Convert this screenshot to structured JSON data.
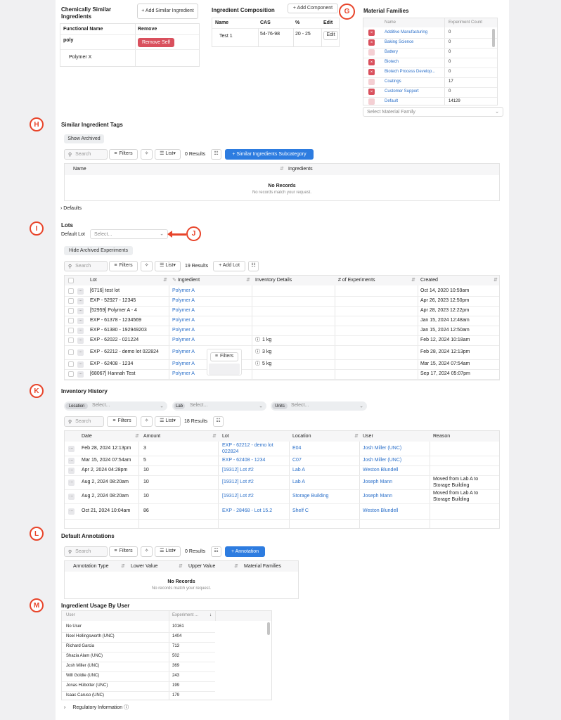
{
  "markers": {
    "g": "G",
    "h": "H",
    "i": "I",
    "j": "J",
    "k": "K",
    "l": "L",
    "m": "M"
  },
  "chem": {
    "title": "Chemically Similar Ingredients",
    "add_label": "+ Add Similar Ingredient",
    "col_name": "Functional Name",
    "col_remove": "Remove",
    "row1_name": "poly",
    "remove_label": "Remove Self",
    "row2_name": "Polymer X"
  },
  "comp": {
    "title": "Ingredient Composition",
    "add_label": "+ Add Component",
    "cols": {
      "name": "Name",
      "cas": "CAS",
      "pct": "%",
      "edit": "Edit"
    },
    "row": {
      "name": "Test 1",
      "cas": "54-76-98",
      "pct": "20 - 25",
      "edit": "Edit"
    }
  },
  "families": {
    "title": "Material Families",
    "col_name": "Name",
    "col_count": "Experiment Count",
    "rows": [
      {
        "name": "Additive Manufacturing",
        "count": "0",
        "on": true
      },
      {
        "name": "Baking Science",
        "count": "0",
        "on": true
      },
      {
        "name": "Battery",
        "count": "0",
        "on": false
      },
      {
        "name": "Biotech",
        "count": "0",
        "on": true
      },
      {
        "name": "Biotech Process Develop...",
        "count": "0",
        "on": true
      },
      {
        "name": "Coatings",
        "count": "17",
        "on": false
      },
      {
        "name": "Customer Support",
        "count": "0",
        "on": true
      },
      {
        "name": "Default",
        "count": "14129",
        "on": false
      }
    ],
    "select_placeholder": "Select Material Family"
  },
  "tags": {
    "title": "Similar Ingredient Tags",
    "show_archived": "Show Archived",
    "search": "Search",
    "filters": "Filters",
    "list": "List",
    "results": "0 Results",
    "primary": "+ Similar Ingredients Subcategory",
    "col_name": "Name",
    "col_ingredients": "Ingredients",
    "empty_title": "No Records",
    "empty_sub": "No records match your request."
  },
  "defaults_label": "Defaults",
  "lots": {
    "title": "Lots",
    "default_lot": "Default Lot",
    "select_placeholder": "Select...",
    "hide_archived": "Hide Archived Experiments",
    "search": "Search",
    "filters": "Filters",
    "list": "List",
    "results": "19 Results",
    "add": "+ Add Lot",
    "cols": {
      "lot": "Lot",
      "ingredient": "Ingredient",
      "inventory": "Inventory Details",
      "experiments": "# of Experiments",
      "created": "Created"
    },
    "rows": [
      {
        "lot": "[6716] test lot",
        "ingredient": "Polymer A",
        "inv": "",
        "created": "Oct 14, 2020 10:59am"
      },
      {
        "lot": "EXP - 52927 - 12345",
        "ingredient": "Polymer A",
        "inv": "",
        "created": "Apr 26, 2023 12:50pm"
      },
      {
        "lot": "[52959] Polymer A - 4",
        "ingredient": "Polymer A",
        "inv": "",
        "created": "Apr 28, 2023 12:22pm"
      },
      {
        "lot": "EXP - 61378 - 1234569",
        "ingredient": "Polymer A",
        "inv": "",
        "created": "Jan 15, 2024 12:48am"
      },
      {
        "lot": "EXP - 61380 - 192949203",
        "ingredient": "Polymer A",
        "inv": "",
        "created": "Jan 15, 2024 12:50am"
      },
      {
        "lot": "EXP - 62022 - 021224",
        "ingredient": "Polymer A",
        "inv": "1 kg",
        "created": "Feb 12, 2024 10:18am"
      },
      {
        "lot": "EXP - 62212 - demo lot 022824",
        "ingredient": "Polymer A",
        "inv": "3 kg",
        "created": "Feb 28, 2024 12:13pm"
      },
      {
        "lot": "EXP - 62408 - 1234",
        "ingredient": "Polymer A",
        "inv": "5 kg",
        "created": "Mar 15, 2024 07:54am"
      },
      {
        "lot": "[68067] Hannah Test",
        "ingredient": "Polymer A",
        "inv": "",
        "created": "Sep 17, 2024 05:07pm"
      }
    ],
    "popup_filters": "Filters"
  },
  "inv": {
    "title": "Inventory History",
    "location": "Location",
    "lab": "Lab",
    "units": "Units",
    "select": "Select...",
    "search": "Search",
    "filters": "Filters",
    "list": "List",
    "results": "18 Results",
    "cols": {
      "date": "Date",
      "amount": "Amount",
      "lot": "Lot",
      "location": "Location",
      "user": "User",
      "reason": "Reason"
    },
    "rows": [
      {
        "date": "Feb 28, 2024 12:13pm",
        "amount": "3",
        "lot": "EXP - 62212 - demo lot 022824",
        "location": "E04",
        "user": "Josh Miller (UNC)",
        "reason": ""
      },
      {
        "date": "Mar 15, 2024 07:54am",
        "amount": "5",
        "lot": "EXP - 62408 - 1234",
        "location": "C07",
        "user": "Josh Miller (UNC)",
        "reason": ""
      },
      {
        "date": "Apr 2, 2024 04:28pm",
        "amount": "10",
        "lot": "[19312] Lot #2",
        "location": "Lab A",
        "user": "Weston Blundell",
        "reason": ""
      },
      {
        "date": "Aug 2, 2024 08:20am",
        "amount": "10",
        "lot": "[19312] Lot #2",
        "location": "Lab A",
        "user": "Joseph Mann",
        "reason": "Moved from Lab A to Storage Building"
      },
      {
        "date": "Aug 2, 2024 08:20am",
        "amount": "10",
        "lot": "[19312] Lot #2",
        "location": "Storage Building",
        "user": "Joseph Mann",
        "reason": "Moved from Lab A to Storage Building"
      },
      {
        "date": "Oct 21, 2024 10:04am",
        "amount": "86",
        "lot": "EXP - 28468 - Lot 15.2",
        "location": "Shelf C",
        "user": "Weston Blundell",
        "reason": ""
      }
    ]
  },
  "annot": {
    "title": "Default Annotations",
    "search": "Search",
    "filters": "Filters",
    "list": "List",
    "results": "0 Results",
    "primary": "+ Annotation",
    "cols": {
      "type": "Annotation Type",
      "lower": "Lower Value",
      "upper": "Upper Value",
      "families": "Material Families"
    },
    "empty_title": "No Records",
    "empty_sub": "No records match your request."
  },
  "usage": {
    "title": "Ingredient Usage By User",
    "col_user": "User",
    "col_count": "Experiment ...",
    "rows": [
      {
        "user": "No User",
        "count": "10161"
      },
      {
        "user": "Noel Hollingsworth (UNC)",
        "count": "1404"
      },
      {
        "user": "Richard Garcia",
        "count": "713"
      },
      {
        "user": "Shazia Alam (UNC)",
        "count": "502"
      },
      {
        "user": "Josh Miller (UNC)",
        "count": "369"
      },
      {
        "user": "Will Goldie (UNC)",
        "count": "243"
      },
      {
        "user": "Jonas Hübotter (UNC)",
        "count": "199"
      },
      {
        "user": "Isaac Caruso (UNC)",
        "count": "179"
      }
    ]
  },
  "regulatory": "Regulatory Information"
}
